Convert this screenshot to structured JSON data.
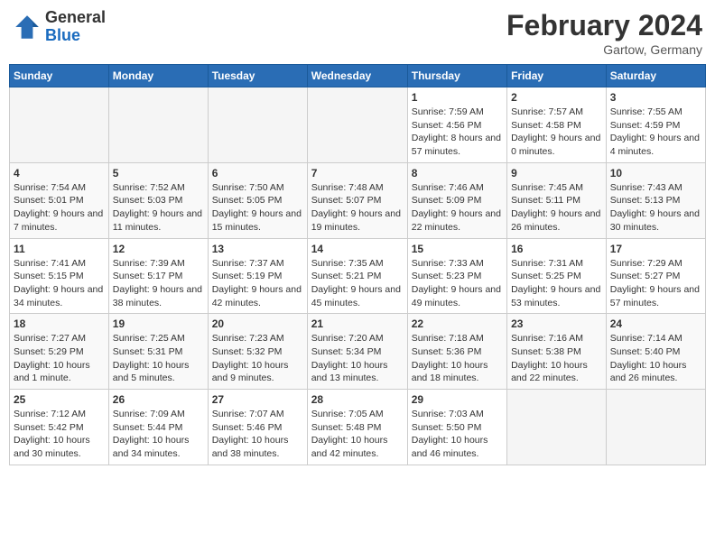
{
  "header": {
    "logo_general": "General",
    "logo_blue": "Blue",
    "main_title": "February 2024",
    "subtitle": "Gartow, Germany"
  },
  "columns": [
    "Sunday",
    "Monday",
    "Tuesday",
    "Wednesday",
    "Thursday",
    "Friday",
    "Saturday"
  ],
  "weeks": [
    [
      {
        "day": "",
        "details": ""
      },
      {
        "day": "",
        "details": ""
      },
      {
        "day": "",
        "details": ""
      },
      {
        "day": "",
        "details": ""
      },
      {
        "day": "1",
        "details": "Sunrise: 7:59 AM\nSunset: 4:56 PM\nDaylight: 8 hours and 57 minutes."
      },
      {
        "day": "2",
        "details": "Sunrise: 7:57 AM\nSunset: 4:58 PM\nDaylight: 9 hours and 0 minutes."
      },
      {
        "day": "3",
        "details": "Sunrise: 7:55 AM\nSunset: 4:59 PM\nDaylight: 9 hours and 4 minutes."
      }
    ],
    [
      {
        "day": "4",
        "details": "Sunrise: 7:54 AM\nSunset: 5:01 PM\nDaylight: 9 hours and 7 minutes."
      },
      {
        "day": "5",
        "details": "Sunrise: 7:52 AM\nSunset: 5:03 PM\nDaylight: 9 hours and 11 minutes."
      },
      {
        "day": "6",
        "details": "Sunrise: 7:50 AM\nSunset: 5:05 PM\nDaylight: 9 hours and 15 minutes."
      },
      {
        "day": "7",
        "details": "Sunrise: 7:48 AM\nSunset: 5:07 PM\nDaylight: 9 hours and 19 minutes."
      },
      {
        "day": "8",
        "details": "Sunrise: 7:46 AM\nSunset: 5:09 PM\nDaylight: 9 hours and 22 minutes."
      },
      {
        "day": "9",
        "details": "Sunrise: 7:45 AM\nSunset: 5:11 PM\nDaylight: 9 hours and 26 minutes."
      },
      {
        "day": "10",
        "details": "Sunrise: 7:43 AM\nSunset: 5:13 PM\nDaylight: 9 hours and 30 minutes."
      }
    ],
    [
      {
        "day": "11",
        "details": "Sunrise: 7:41 AM\nSunset: 5:15 PM\nDaylight: 9 hours and 34 minutes."
      },
      {
        "day": "12",
        "details": "Sunrise: 7:39 AM\nSunset: 5:17 PM\nDaylight: 9 hours and 38 minutes."
      },
      {
        "day": "13",
        "details": "Sunrise: 7:37 AM\nSunset: 5:19 PM\nDaylight: 9 hours and 42 minutes."
      },
      {
        "day": "14",
        "details": "Sunrise: 7:35 AM\nSunset: 5:21 PM\nDaylight: 9 hours and 45 minutes."
      },
      {
        "day": "15",
        "details": "Sunrise: 7:33 AM\nSunset: 5:23 PM\nDaylight: 9 hours and 49 minutes."
      },
      {
        "day": "16",
        "details": "Sunrise: 7:31 AM\nSunset: 5:25 PM\nDaylight: 9 hours and 53 minutes."
      },
      {
        "day": "17",
        "details": "Sunrise: 7:29 AM\nSunset: 5:27 PM\nDaylight: 9 hours and 57 minutes."
      }
    ],
    [
      {
        "day": "18",
        "details": "Sunrise: 7:27 AM\nSunset: 5:29 PM\nDaylight: 10 hours and 1 minute."
      },
      {
        "day": "19",
        "details": "Sunrise: 7:25 AM\nSunset: 5:31 PM\nDaylight: 10 hours and 5 minutes."
      },
      {
        "day": "20",
        "details": "Sunrise: 7:23 AM\nSunset: 5:32 PM\nDaylight: 10 hours and 9 minutes."
      },
      {
        "day": "21",
        "details": "Sunrise: 7:20 AM\nSunset: 5:34 PM\nDaylight: 10 hours and 13 minutes."
      },
      {
        "day": "22",
        "details": "Sunrise: 7:18 AM\nSunset: 5:36 PM\nDaylight: 10 hours and 18 minutes."
      },
      {
        "day": "23",
        "details": "Sunrise: 7:16 AM\nSunset: 5:38 PM\nDaylight: 10 hours and 22 minutes."
      },
      {
        "day": "24",
        "details": "Sunrise: 7:14 AM\nSunset: 5:40 PM\nDaylight: 10 hours and 26 minutes."
      }
    ],
    [
      {
        "day": "25",
        "details": "Sunrise: 7:12 AM\nSunset: 5:42 PM\nDaylight: 10 hours and 30 minutes."
      },
      {
        "day": "26",
        "details": "Sunrise: 7:09 AM\nSunset: 5:44 PM\nDaylight: 10 hours and 34 minutes."
      },
      {
        "day": "27",
        "details": "Sunrise: 7:07 AM\nSunset: 5:46 PM\nDaylight: 10 hours and 38 minutes."
      },
      {
        "day": "28",
        "details": "Sunrise: 7:05 AM\nSunset: 5:48 PM\nDaylight: 10 hours and 42 minutes."
      },
      {
        "day": "29",
        "details": "Sunrise: 7:03 AM\nSunset: 5:50 PM\nDaylight: 10 hours and 46 minutes."
      },
      {
        "day": "",
        "details": ""
      },
      {
        "day": "",
        "details": ""
      }
    ]
  ]
}
